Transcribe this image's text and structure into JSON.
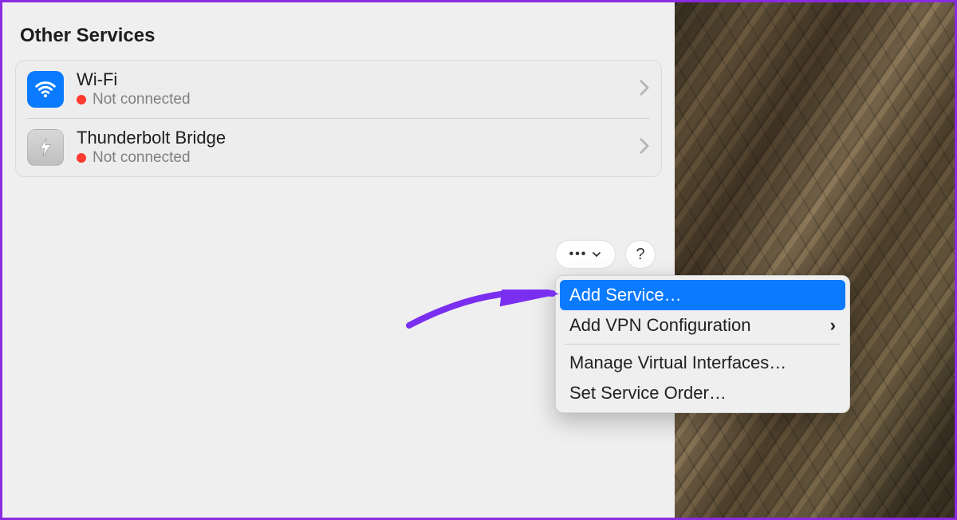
{
  "section": {
    "title": "Other Services"
  },
  "services": [
    {
      "name": "Wi-Fi",
      "status": "Not connected"
    },
    {
      "name": "Thunderbolt Bridge",
      "status": "Not connected"
    }
  ],
  "actions": {
    "help": "?"
  },
  "menu": {
    "items": [
      {
        "label": "Add Service…",
        "highlight": true
      },
      {
        "label": "Add VPN Configuration",
        "submenu": true
      }
    ],
    "items2": [
      {
        "label": "Manage Virtual Interfaces…"
      },
      {
        "label": "Set Service Order…"
      }
    ]
  }
}
